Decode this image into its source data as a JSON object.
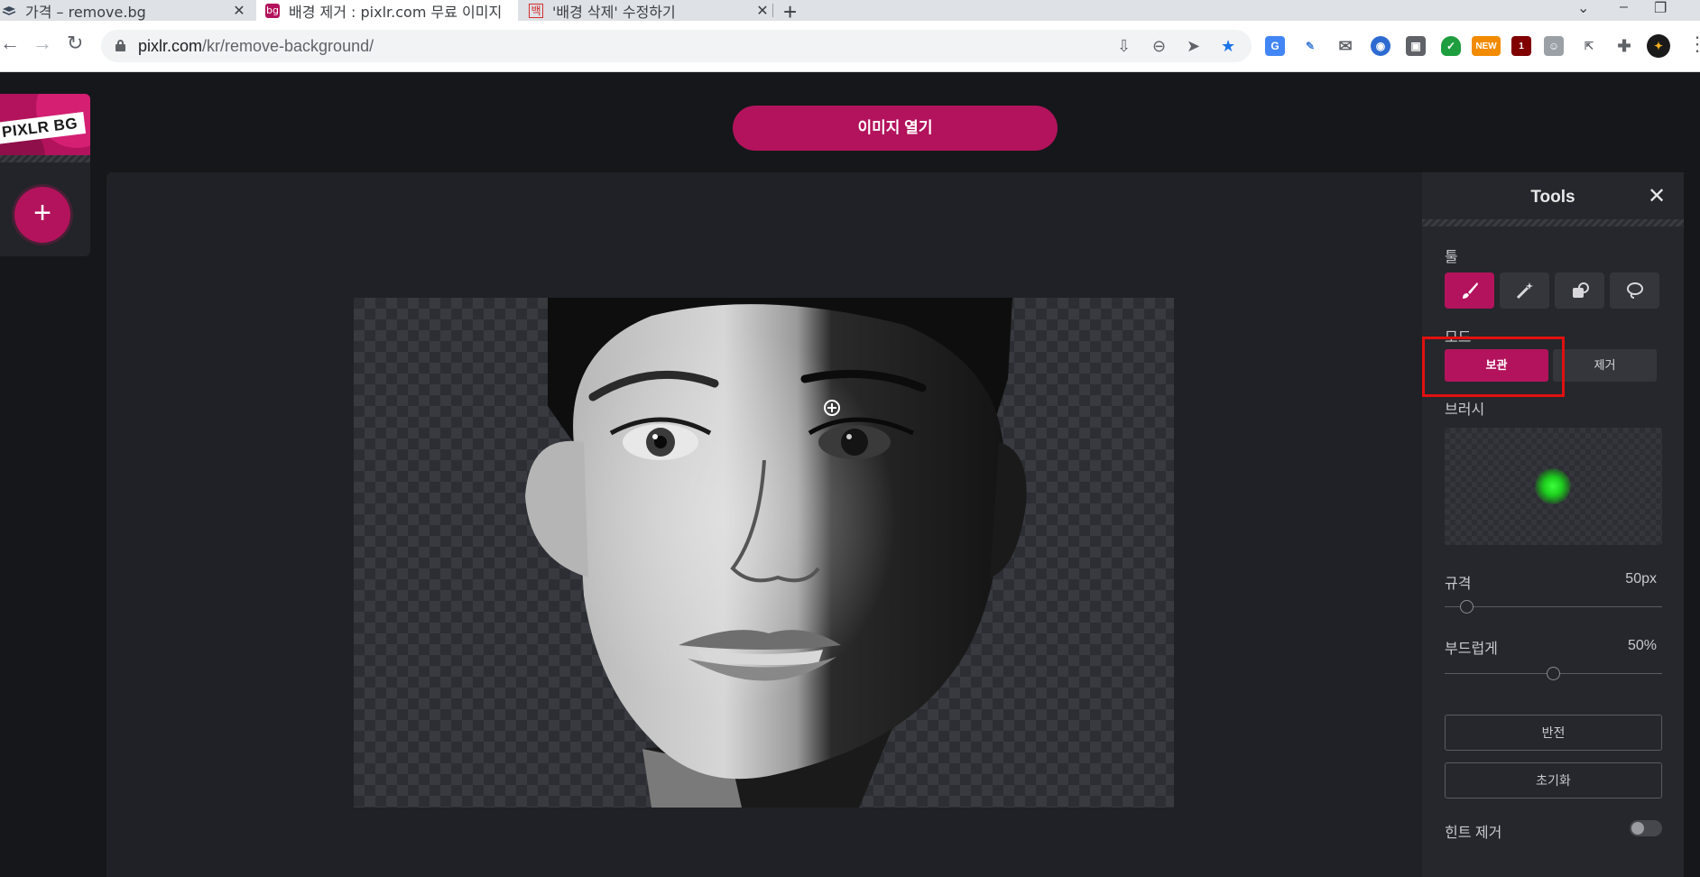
{
  "browser": {
    "tabs": [
      {
        "title": "가격 – remove.bg",
        "favicon": "removebg-logo-icon",
        "active": false
      },
      {
        "title": "배경 제거 : pixlr.com 무료 이미지",
        "favicon": "pixlr-logo-icon",
        "active": true
      },
      {
        "title": "'배경 삭제' 수정하기",
        "favicon": "baek-logo-icon",
        "active": false
      }
    ],
    "new_tab": "+",
    "url_host": "pixlr.com",
    "url_path": "/kr/remove-background/",
    "extensions_badge_new": "NEW",
    "extensions_badge_count": "1"
  },
  "app": {
    "logo_text": "PIXLR BG",
    "add_label": "+",
    "open_image_label": "이미지 열기"
  },
  "tools_panel": {
    "title": "Tools",
    "close": "✕",
    "tool_section_label": "툴",
    "tools": [
      "brush-icon",
      "magic-wand-icon",
      "shape-eraser-icon",
      "lasso-icon"
    ],
    "mode_label": "모드",
    "mode_keep": "보관",
    "mode_remove": "제거",
    "brush_label": "브러시",
    "brush_color": "#22dd22",
    "size_label": "규격",
    "size_value": "50px",
    "size_fraction": 0.1,
    "softness_label": "부드럽게",
    "softness_value": "50%",
    "softness_fraction": 0.5,
    "invert_label": "반전",
    "reset_label": "초기화",
    "hint_label": "힌트 제거",
    "hint_enabled": false
  },
  "colors": {
    "accent": "#b3135c",
    "highlight_box": "#e01010"
  }
}
